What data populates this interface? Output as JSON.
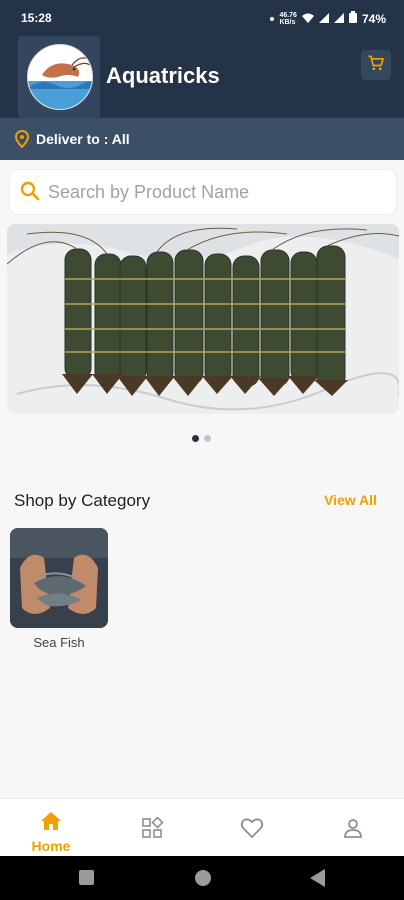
{
  "status_bar": {
    "time": "15:28",
    "network": "46.76\nKB/s",
    "battery": "74%"
  },
  "header": {
    "app_title": "Aquatricks",
    "logo_icon": "shrimp-logo-icon",
    "cart_icon": "cart-icon"
  },
  "delivery": {
    "label": "Deliver to : All",
    "icon": "location-pin-icon"
  },
  "search": {
    "placeholder": "Search by Product Name",
    "icon": "search-icon"
  },
  "carousel": {
    "image": "prawns-on-sheet",
    "dots_total": 2,
    "active_index": 0
  },
  "categories_section": {
    "title": "Shop by Category",
    "view_all": "View All",
    "items": [
      {
        "label": "Sea Fish",
        "image": "hands-with-fish"
      }
    ]
  },
  "bottom_nav": {
    "items": [
      {
        "label": "Home",
        "icon": "home-icon",
        "active": true
      },
      {
        "label": "",
        "icon": "categories-icon",
        "active": false
      },
      {
        "label": "",
        "icon": "heart-icon",
        "active": false
      },
      {
        "label": "",
        "icon": "profile-icon",
        "active": false
      }
    ]
  },
  "colors": {
    "header_bg": "#243347",
    "accent": "#f2a000",
    "deliver_bar_bg": "#3b4f66"
  }
}
